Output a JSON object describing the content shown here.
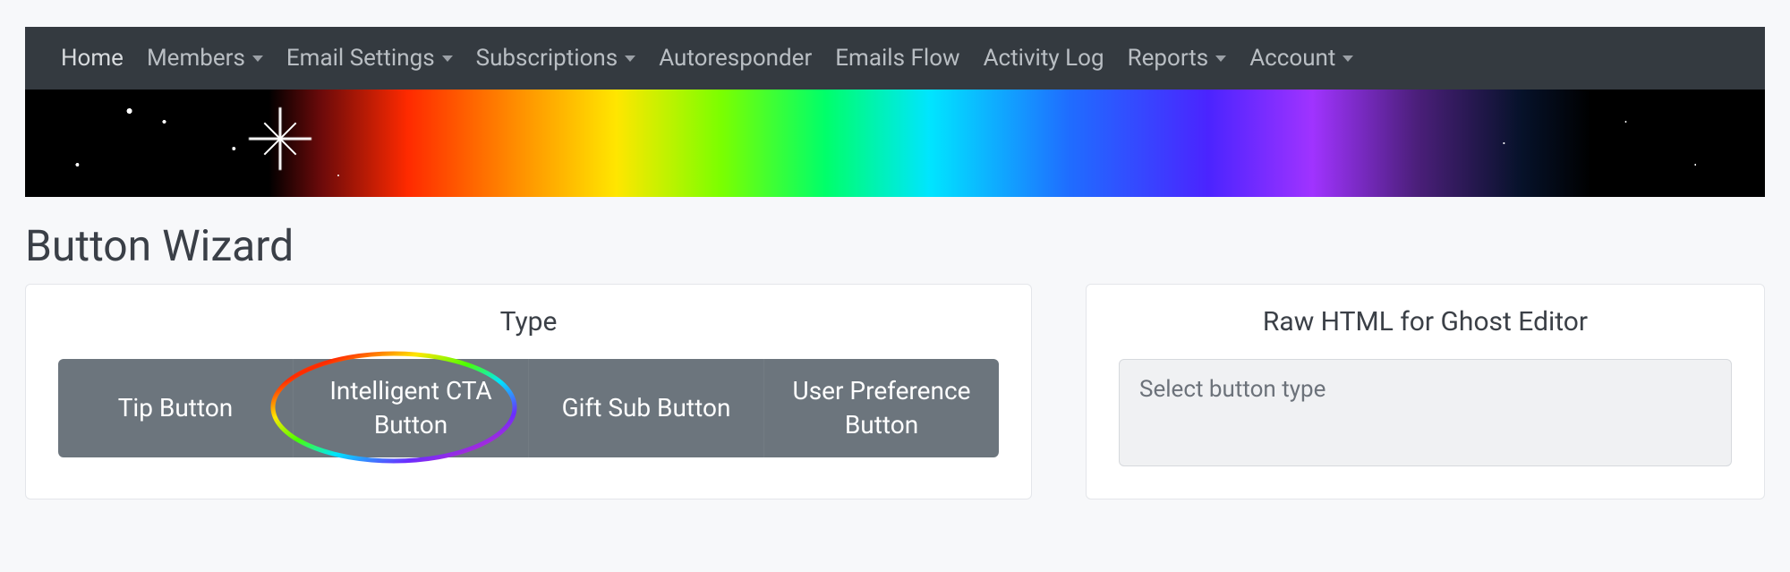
{
  "nav": {
    "home": "Home",
    "members": "Members",
    "email_settings": "Email Settings",
    "subscriptions": "Subscriptions",
    "autoresponder": "Autoresponder",
    "emails_flow": "Emails Flow",
    "activity_log": "Activity Log",
    "reports": "Reports",
    "account": "Account"
  },
  "page": {
    "title": "Button Wizard"
  },
  "type_panel": {
    "title": "Type",
    "options": {
      "tip": "Tip Button",
      "intelligent_cta": "Intelligent CTA Button",
      "gift_sub": "Gift Sub Button",
      "user_preference": "User Preference Button"
    }
  },
  "output_panel": {
    "title": "Raw HTML for Ghost Editor",
    "placeholder": "Select button type"
  }
}
